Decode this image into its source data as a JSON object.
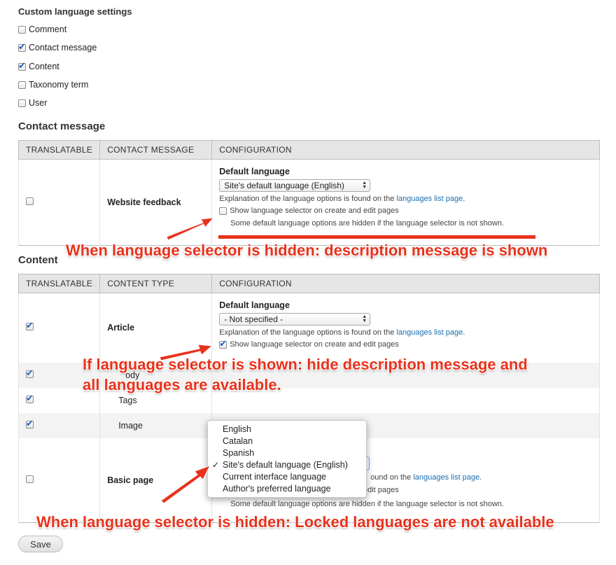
{
  "settings": {
    "title": "Custom language settings",
    "items": [
      {
        "label": "Comment",
        "checked": false
      },
      {
        "label": "Contact message",
        "checked": true
      },
      {
        "label": "Content",
        "checked": true
      },
      {
        "label": "Taxonomy term",
        "checked": false
      },
      {
        "label": "User",
        "checked": false
      }
    ]
  },
  "contact": {
    "title": "Contact message",
    "headers": [
      "TRANSLATABLE",
      "CONTACT MESSAGE",
      "CONFIGURATION"
    ],
    "row": {
      "label": "Website feedback",
      "default_language_title": "Default language",
      "select_value": "Site's default language (English)",
      "explanation": "Explanation of the language options is found on the ",
      "explanation_link": "languages list page",
      "explanation_end": ".",
      "show_selector_label": "Show language selector on create and edit pages",
      "hidden_note": "Some default language options are hidden if the language selector is not shown."
    }
  },
  "content": {
    "title": "Content",
    "headers": [
      "TRANSLATABLE",
      "CONTENT TYPE",
      "CONFIGURATION"
    ],
    "article": {
      "label": "Article",
      "default_language_title": "Default language",
      "select_value": "- Not specified -",
      "explanation": "Explanation of the language options is found on the ",
      "explanation_link": "languages list page",
      "explanation_end": ".",
      "show_selector_label": "Show language selector on create and edit pages"
    },
    "sub_rows": [
      {
        "label": "Body",
        "visible_fragment": "ody"
      },
      {
        "label": "Tags"
      },
      {
        "label": "Image"
      }
    ],
    "basic_page": {
      "label": "Basic page",
      "explanation_visible": "ound on the ",
      "explanation_link": "languages list page",
      "explanation_end": ".",
      "selector_visible_fragment": "Show language selector on create and edit pages",
      "hidden_note": "Some default language options are hidden if the language selector is not shown."
    }
  },
  "dropdown": {
    "options": [
      {
        "label": "English",
        "selected": false
      },
      {
        "label": "Catalan",
        "selected": false
      },
      {
        "label": "Spanish",
        "selected": false
      },
      {
        "label": "Site's default language (English)",
        "selected": true
      },
      {
        "label": "Current interface language",
        "selected": false
      },
      {
        "label": "Author's preferred language",
        "selected": false
      }
    ],
    "check_mark": "✓"
  },
  "annotations": {
    "a1": "When language selector is hidden: description message is shown",
    "a2_line1": "If language selector is shown: hide description message and",
    "a2_line2": "all languages are available.",
    "a3": "When language selector is hidden: Locked languages are not available",
    "color": "#e8321c"
  },
  "buttons": {
    "save": "Save"
  }
}
